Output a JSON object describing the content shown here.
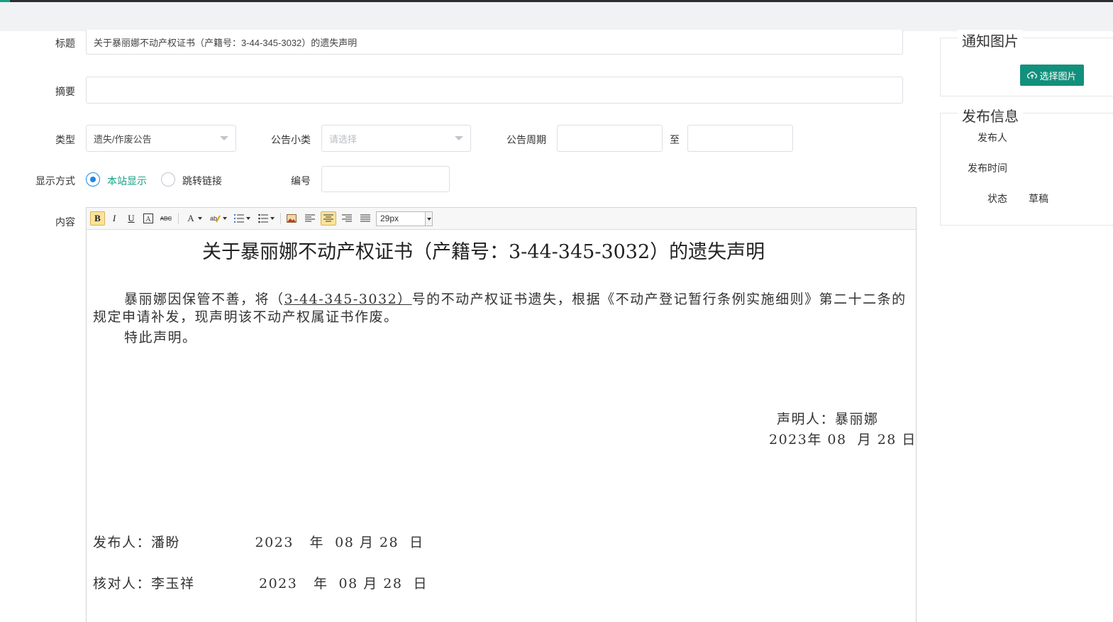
{
  "form": {
    "title_label": "标题",
    "title_value": "关于暴丽娜不动产权证书（产籍号：3-44-345-3032）的遗失声明",
    "summary_label": "摘要",
    "summary_value": "",
    "type_label": "类型",
    "type_value": "遗失/作废公告",
    "subtype_label": "公告小类",
    "subtype_placeholder": "请选择",
    "period_label": "公告周期",
    "period_start": "",
    "period_to": "至",
    "period_end": "",
    "display_label": "显示方式",
    "display_options": [
      {
        "label": "本站显示",
        "checked": true
      },
      {
        "label": "跳转链接",
        "checked": false
      }
    ],
    "number_label": "编号",
    "number_value": "",
    "content_label": "内容"
  },
  "editor": {
    "toolbar": {
      "bold": "B",
      "italic": "I",
      "underline": "U",
      "font_size": "29px"
    },
    "document": {
      "title": "关于暴丽娜不动产权证书（产籍号：3-44-345-3032）的遗失声明",
      "para1_before": "暴丽娜因保管不善，将（",
      "para1_underlined": "3-44-345-3032）",
      "para1_after": "号的不动产权证书遗失，根据《不动产登记暂行条例实施细则》第二十二条的",
      "para1_line2": "规定申请补发，现声明该不动产权属证书作废。",
      "para2": "特此声明。",
      "declarant": "声明人：暴丽娜",
      "declare_date": "2023年 08  月 28 日",
      "publisher_line": "发布人：潘盼              2023   年  08 月 28  日",
      "checker_line": "核对人：李玉祥            2023   年  08 月 28  日"
    }
  },
  "side": {
    "image_title": "通知图片",
    "upload_button": "选择图片",
    "publish_title": "发布信息",
    "publisher_label": "发布人",
    "publisher_value": "",
    "publish_time_label": "发布时间",
    "publish_time_value": "",
    "status_label": "状态",
    "status_value": "草稿"
  },
  "colors": {
    "accent": "#11907c",
    "radio_checked": "#1e88e5",
    "checked_label": "#16a085"
  }
}
